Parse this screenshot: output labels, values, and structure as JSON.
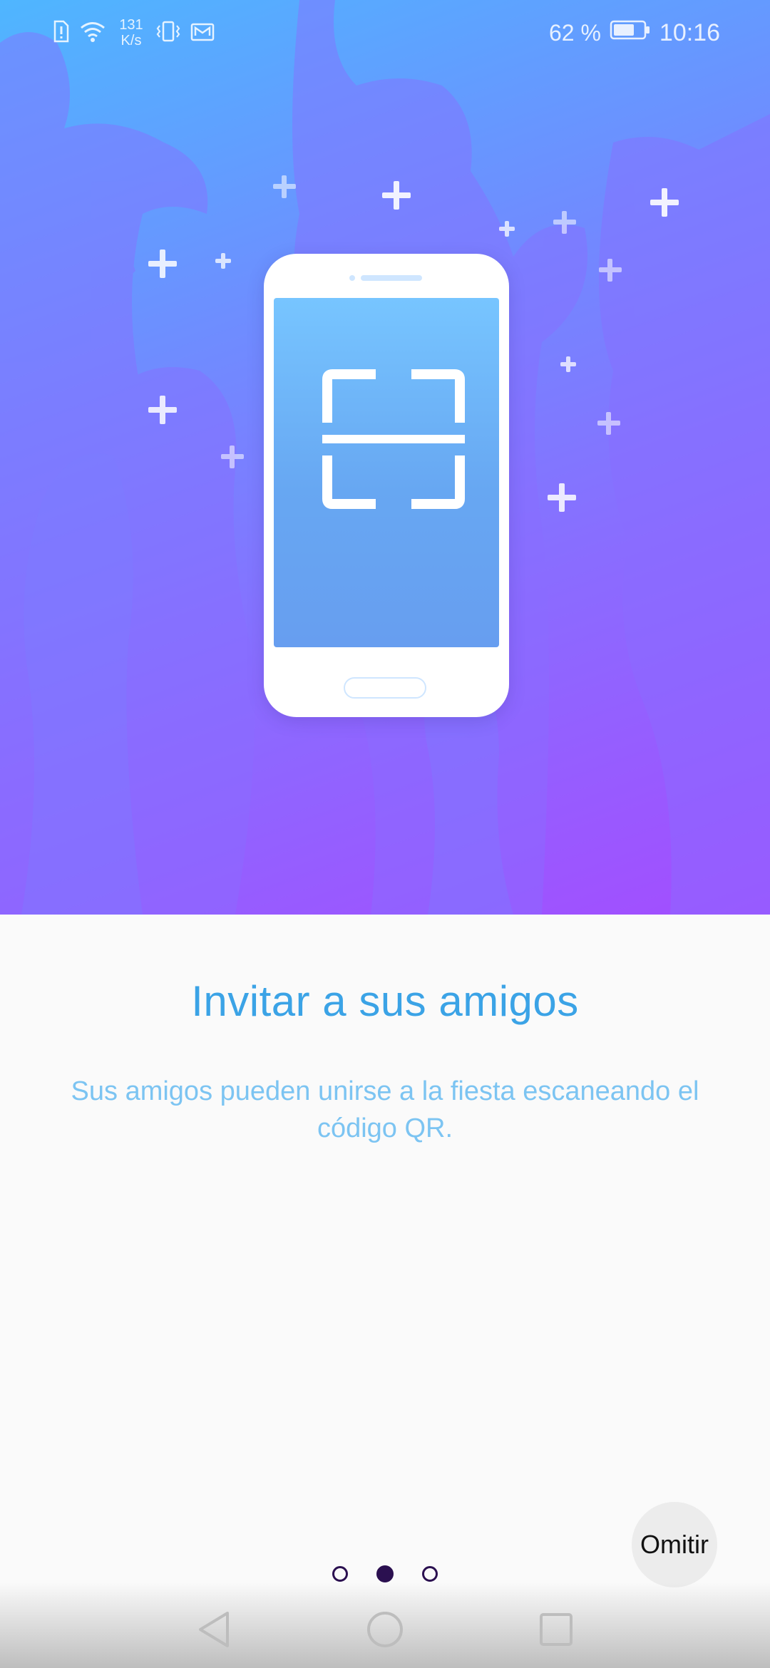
{
  "status_bar": {
    "network_speed_value": "131",
    "network_speed_unit": "K/s",
    "battery_percent": "62 %",
    "time": "10:16",
    "icons": [
      "sim-alert-icon",
      "wifi-icon",
      "vibrate-icon",
      "mail-icon",
      "battery-icon"
    ]
  },
  "onboarding": {
    "title": "Invitar a sus amigos",
    "description": "Sus amigos pueden unirse a la fiesta escaneando el código QR.",
    "illustration_icon": "qr-scan-icon",
    "skip_label": "Omitir",
    "pages": 3,
    "current_page": 2
  },
  "navigation_bar": {
    "buttons": [
      "back-icon",
      "home-icon",
      "recent-apps-icon"
    ]
  },
  "colors": {
    "title": "#3ba3e6",
    "description": "#7cc4f2",
    "hero_gradient_start": "#4fb6ff",
    "hero_gradient_end": "#a34dff",
    "dot": "#2b1050"
  }
}
